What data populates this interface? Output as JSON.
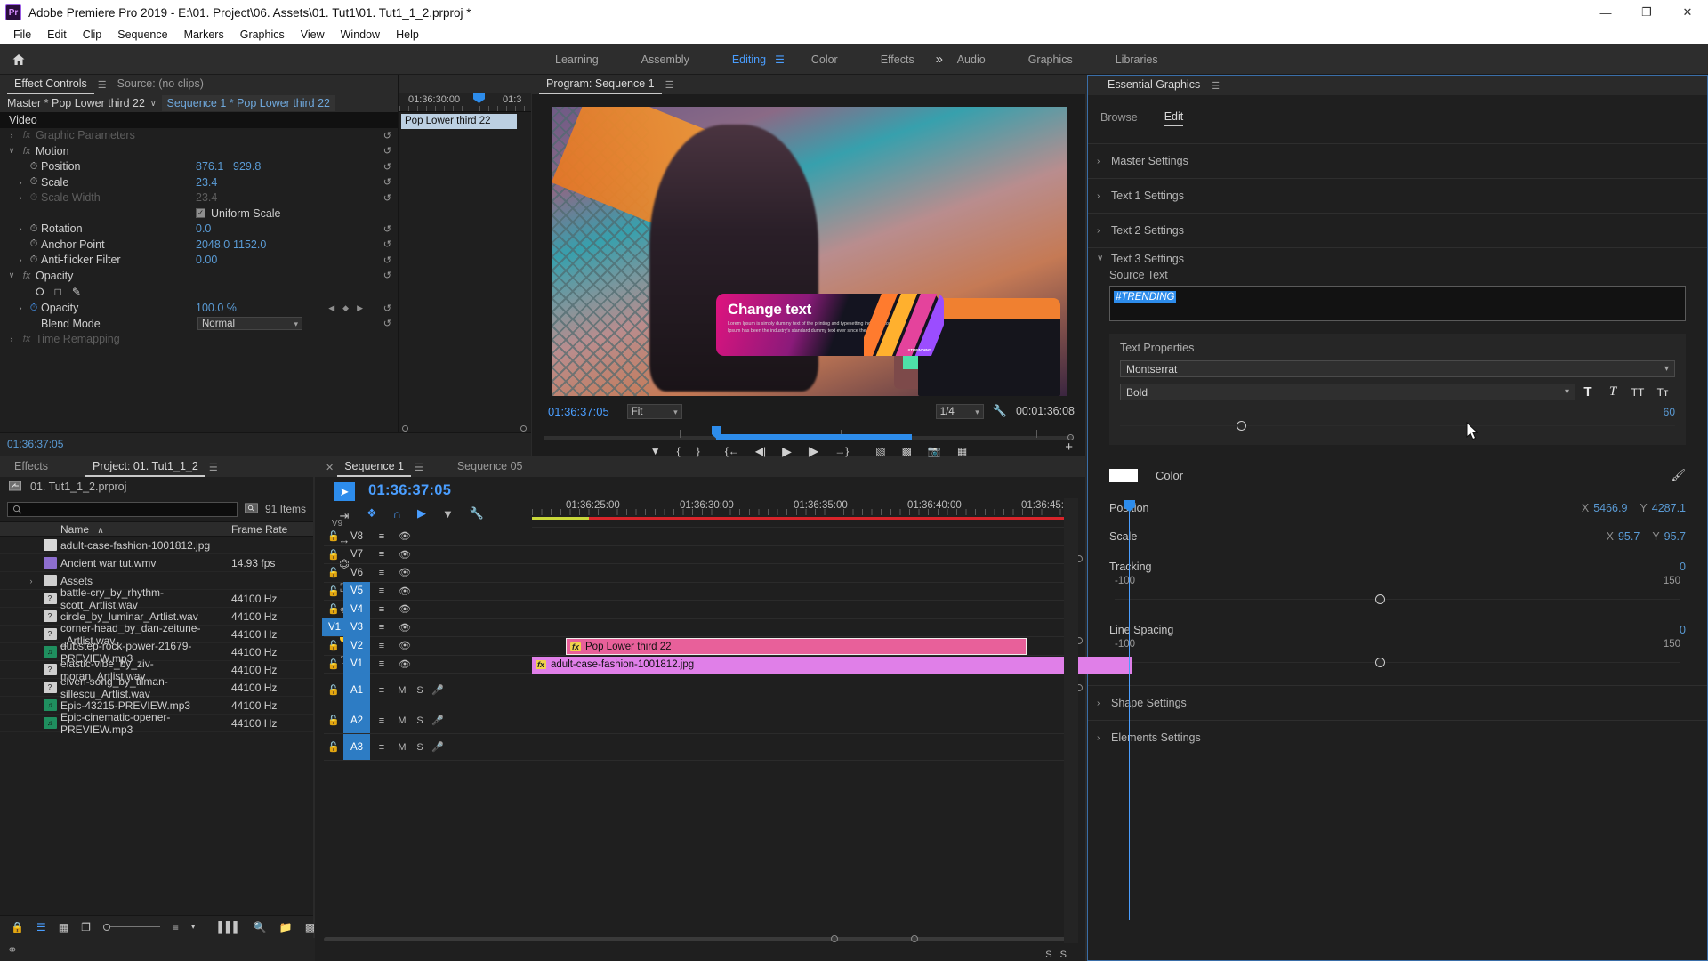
{
  "window": {
    "title": "Adobe Premiere Pro 2019 - E:\\01. Project\\06. Assets\\01. Tut1\\01. Tut1_1_2.prproj *",
    "app_badge": "Pr",
    "minimize": "—",
    "maximize": "❐",
    "close": "✕"
  },
  "menu": [
    "File",
    "Edit",
    "Clip",
    "Sequence",
    "Markers",
    "Graphics",
    "View",
    "Window",
    "Help"
  ],
  "workspace": {
    "home_icon": "home-icon",
    "tabs": [
      "Learning",
      "Assembly",
      "Editing",
      "Color",
      "Effects",
      "Audio",
      "Graphics",
      "Libraries"
    ],
    "active_tab": "Editing",
    "burger": "☰",
    "more": "»"
  },
  "effect_controls": {
    "tabs": [
      {
        "label": "Effect Controls",
        "active": true
      },
      {
        "label": "Source: (no clips)",
        "active": false
      }
    ],
    "burger": "☰",
    "breadcrumb_master": "Master * Pop Lower third 22",
    "breadcrumb_caret": "∨",
    "breadcrumb_sequence": "Sequence 1 * Pop Lower third 22",
    "section_video": "Video",
    "rows": [
      {
        "name": "Graphic Parameters",
        "kind": "group",
        "fx": true,
        "arrow": "›",
        "dim": true
      },
      {
        "name": "Motion",
        "kind": "group",
        "fx": true,
        "arrow": "∨"
      },
      {
        "name": "Position",
        "v1": "876.1",
        "v2": "929.8",
        "sw": true
      },
      {
        "name": "Scale",
        "v1": "23.4",
        "sw": true,
        "arrow": "›"
      },
      {
        "name": "Scale Width",
        "v1": "23.4",
        "sw": true,
        "arrow": "›",
        "dim": true
      },
      {
        "name": "Uniform Scale",
        "kind": "checkbox",
        "checked": true
      },
      {
        "name": "Rotation",
        "v1": "0.0",
        "sw": true,
        "arrow": "›"
      },
      {
        "name": "Anchor Point",
        "v1": "2048.0",
        "v2": "1152.0",
        "sw": true
      },
      {
        "name": "Anti-flicker Filter",
        "v1": "0.00",
        "sw": true,
        "arrow": "›"
      },
      {
        "name": "Opacity",
        "kind": "group",
        "fx": true,
        "arrow": "∨"
      },
      {
        "name": "mask-tools",
        "kind": "icons"
      },
      {
        "name": "Opacity",
        "v1": "100.0 %",
        "sw": true,
        "arrow": "›",
        "kfnav": true
      },
      {
        "name": "Blend Mode",
        "kind": "select",
        "value": "Normal"
      },
      {
        "name": "Time Remapping",
        "kind": "group",
        "fx": true,
        "arrow": "›",
        "dim": true
      }
    ],
    "mini_timeline": {
      "tick_label_1": "01:36:30:00",
      "tick_label_2": "01:3",
      "clip_name": "Pop Lower third 22"
    },
    "footer_timecode": "01:36:37:05"
  },
  "program_monitor": {
    "tab": "Program: Sequence 1",
    "burger": "☰",
    "timecode": "01:36:37:05",
    "fit": "Fit",
    "resolution": "1/4",
    "wrench": "wrench-icon",
    "duration": "00:01:36:08",
    "overlay": {
      "headline": "Change text",
      "body": "Lorem Ipsum is simply dummy text of the printing and typesetting industry. Lorem Ipsum has been the industry's standard dummy text ever since the 1500s.",
      "tag": "#TRENDING"
    },
    "buttons": [
      "marker-icon",
      "mark-in-icon",
      "mark-out-icon",
      "go-to-in-icon",
      "step-back-icon",
      "play-icon",
      "step-forward-icon",
      "go-to-out-icon",
      "lift-icon",
      "extract-icon",
      "export-frame-icon",
      "comparison-view-icon"
    ],
    "plus": "+"
  },
  "essential_graphics": {
    "title": "Essential Graphics",
    "burger": "☰",
    "tabs": [
      "Browse",
      "Edit"
    ],
    "active_tab": "Edit",
    "sections": [
      {
        "label": "Master Settings",
        "expanded": false,
        "arrow": "›"
      },
      {
        "label": "Text 1 Settings",
        "expanded": false,
        "arrow": "›"
      },
      {
        "label": "Text 2 Settings",
        "expanded": false,
        "arrow": "›"
      },
      {
        "label": "Text 3 Settings",
        "expanded": true,
        "arrow": "∨"
      }
    ],
    "source_text_label": "Source Text",
    "source_text_value": "#TRENDING",
    "text_properties_label": "Text Properties",
    "font_family": "Montserrat",
    "font_style": "Bold",
    "style_buttons": [
      "bold-icon",
      "italic-icon",
      "all-caps-icon",
      "small-caps-icon"
    ],
    "font_size": "60",
    "color_label": "Color",
    "color_value": "#FFFFFF",
    "eyedropper": "eyedropper-icon",
    "position_label": "Position",
    "position_x_axis": "X",
    "position_x": "5466.9",
    "position_y_axis": "Y",
    "position_y": "4287.1",
    "scale_label": "Scale",
    "scale_x_axis": "X",
    "scale_x": "95.7",
    "scale_y_axis": "Y",
    "scale_y": "95.7",
    "tracking": {
      "label": "Tracking",
      "value": "0",
      "min": "-100",
      "max": "150"
    },
    "line_spacing": {
      "label": "Line Spacing",
      "value": "0",
      "min": "-100",
      "max": "150"
    },
    "bottom_sections": [
      {
        "label": "Shape Settings",
        "arrow": "›"
      },
      {
        "label": "Elements Settings",
        "arrow": "›"
      }
    ]
  },
  "project_panel": {
    "tabs": [
      {
        "label": "Effects",
        "active": false
      },
      {
        "label": "Project: 01. Tut1_1_2",
        "active": true
      }
    ],
    "burger": "☰",
    "project_file": "01. Tut1_1_2.prproj",
    "search_placeholder": "",
    "search_icon": "search-icon",
    "filter_icon": "filter-bin-icon",
    "items_count": "91 Items",
    "columns": [
      "Name",
      "Frame Rate"
    ],
    "sort_arrow": "∧",
    "items": [
      {
        "name": "adult-case-fashion-1001812.jpg",
        "rate": "",
        "chip": "#d96fe0",
        "icon": "image-icon",
        "icon_bg": "#d8d8d8"
      },
      {
        "name": "Ancient war tut.wmv",
        "rate": "14.93 fps",
        "chip": "#6b8fd4",
        "icon": "video-icon",
        "icon_bg": "#8e6fd0"
      },
      {
        "name": "Assets",
        "rate": "",
        "chip": "#e0a63a",
        "icon": "folder-icon",
        "icon_bg": "#cfcfcf",
        "expandable": true
      },
      {
        "name": "battle-cry_by_rhythm-scott_Artlist.wav",
        "rate": "44100 Hz",
        "chip": "#3ddc91",
        "icon": "unknown-icon",
        "icon_bg": "#cfcfcf"
      },
      {
        "name": "circle_by_luminar_Artlist.wav",
        "rate": "44100 Hz",
        "chip": "#3ddc91",
        "icon": "unknown-icon",
        "icon_bg": "#cfcfcf"
      },
      {
        "name": "corner-head_by_dan-zeitune-_Artlist.wav",
        "rate": "44100 Hz",
        "chip": "#3ddc91",
        "icon": "unknown-icon",
        "icon_bg": "#cfcfcf"
      },
      {
        "name": "dubstep-rock-power-21679-PREVIEW.mp3",
        "rate": "44100 Hz",
        "chip": "#3ddc91",
        "icon": "audio-icon",
        "icon_bg": "#1f8f5f"
      },
      {
        "name": "elastic-vibe_by_ziv-moran_Artlist.wav",
        "rate": "44100 Hz",
        "chip": "#3ddc91",
        "icon": "unknown-icon",
        "icon_bg": "#cfcfcf"
      },
      {
        "name": "elven-song_by_tilman-sillescu_Artlist.wav",
        "rate": "44100 Hz",
        "chip": "#3ddc91",
        "icon": "unknown-icon",
        "icon_bg": "#cfcfcf"
      },
      {
        "name": "Epic-43215-PREVIEW.mp3",
        "rate": "44100 Hz",
        "chip": "#3ddc91",
        "icon": "audio-icon",
        "icon_bg": "#1f8f5f"
      },
      {
        "name": "Epic-cinematic-opener-PREVIEW.mp3",
        "rate": "44100 Hz",
        "chip": "#3ddc91",
        "icon": "audio-icon",
        "icon_bg": "#1f8f5f"
      }
    ],
    "footer_icons": [
      "lock-icon",
      "list-view-icon",
      "icon-view-icon",
      "freeform-view-icon",
      "zoom-slider",
      "sort-icon",
      "chevron-down-icon",
      "automate-to-sequence-icon",
      "find-icon",
      "new-bin-icon",
      "new-item-icon",
      "delete-icon"
    ]
  },
  "timeline": {
    "tabs": [
      {
        "label": "Sequence 1",
        "active": true
      },
      {
        "label": "Sequence 05",
        "active": false
      }
    ],
    "close": "✕",
    "burger": "☰",
    "timecode": "01:36:37:05",
    "tools": [
      "selection-tool",
      "track-select-forward-tool",
      "ripple-edit-tool",
      "razor-tool",
      "slip-tool",
      "pen-tool",
      "hand-tool",
      "type-tool"
    ],
    "active_tool": "selection-tool",
    "header_icons": [
      "nest-icon",
      "snap-icon",
      "linked-selection-icon",
      "add-marker-icon",
      "timeline-settings-icon"
    ],
    "ruler_labels": [
      "01:36:25:00",
      "01:36:30:00",
      "01:36:35:00",
      "01:36:40:00",
      "01:36:45:00"
    ],
    "video_tracks": [
      {
        "name": "V8",
        "targeted": false
      },
      {
        "name": "V7",
        "targeted": false
      },
      {
        "name": "V6",
        "targeted": false
      },
      {
        "name": "V5",
        "targeted": true
      },
      {
        "name": "V4",
        "targeted": true
      },
      {
        "name": "V3",
        "targeted": true
      },
      {
        "name": "V2",
        "targeted": true
      },
      {
        "name": "V1",
        "targeted": true
      }
    ],
    "partial_top_track": "V9",
    "source_patch_label": "V1",
    "audio_tracks": [
      {
        "name": "A1",
        "targeted": true,
        "mute": "M",
        "solo": "S",
        "rec": "mic-icon"
      },
      {
        "name": "A2",
        "targeted": true,
        "mute": "M",
        "solo": "S",
        "rec": "mic-icon"
      },
      {
        "name": "A3",
        "targeted": true,
        "mute": "M",
        "solo": "S",
        "rec": "mic-icon"
      }
    ],
    "clips": [
      {
        "track": "V2",
        "name": "Pop Lower third 22",
        "fx": "fx",
        "color": "#e8609a",
        "selected": true
      },
      {
        "track": "V1",
        "name": "adult-case-fashion-1001812.jpg",
        "fx": "fx",
        "color": "#e07fe8",
        "selected": false
      }
    ],
    "master_meters": "S S"
  }
}
